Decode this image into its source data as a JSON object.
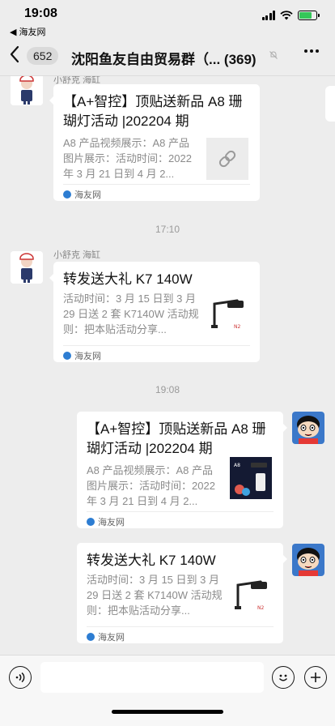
{
  "status_bar": {
    "time": "19:08",
    "back_app": "◀ 海友网",
    "battery_level": 0.75,
    "battery_color": "#34c759"
  },
  "nav": {
    "back_icon": "chevron-left-icon",
    "unread_count": "652",
    "title": "沈阳鱼友自由贸易群（...",
    "member_count": "(369)",
    "more_icon": "more-dots-icon"
  },
  "messages": [
    {
      "side": "left",
      "sender": "小舒克 海缸",
      "title": "【A+智控】顶贴送新品 A8 珊瑚灯活动 |202204 期",
      "desc": "A8 产品视频展示：A8 产品图片展示：活动时间：2022 年 3 月 21 日到 4 月 2...",
      "thumb": "link-icon",
      "source": "海友网"
    },
    {
      "time": "17:10"
    },
    {
      "side": "left",
      "sender": "小舒克 海缸",
      "title": "转发送大礼  K7 140W",
      "desc": "活动时间：3 月 15 日到 3 月 29 日送 2 套 K7140W 活动规则：把本贴活动分享...",
      "thumb": "lamp-product-image",
      "source": "海友网"
    },
    {
      "time": "19:08"
    },
    {
      "side": "right",
      "title": "【A+智控】顶贴送新品 A8 珊瑚灯活动 |202204 期",
      "desc": "A8 产品视频展示：A8 产品图片展示：活动时间：2022 年 3 月 21 日到 4 月 2...",
      "thumb": "aquarium-product-image",
      "source": "海友网"
    },
    {
      "side": "right",
      "title": "转发送大礼  K7 140W",
      "desc": "活动时间：3 月 15 日到 3 月 29 日送 2 套 K7140W 活动规则：把本贴活动分享...",
      "thumb": "lamp-product-image",
      "source": "海友网"
    }
  ],
  "input_bar": {
    "voice_icon": "voice-icon",
    "emoji_icon": "emoji-icon",
    "plus_icon": "plus-icon"
  }
}
